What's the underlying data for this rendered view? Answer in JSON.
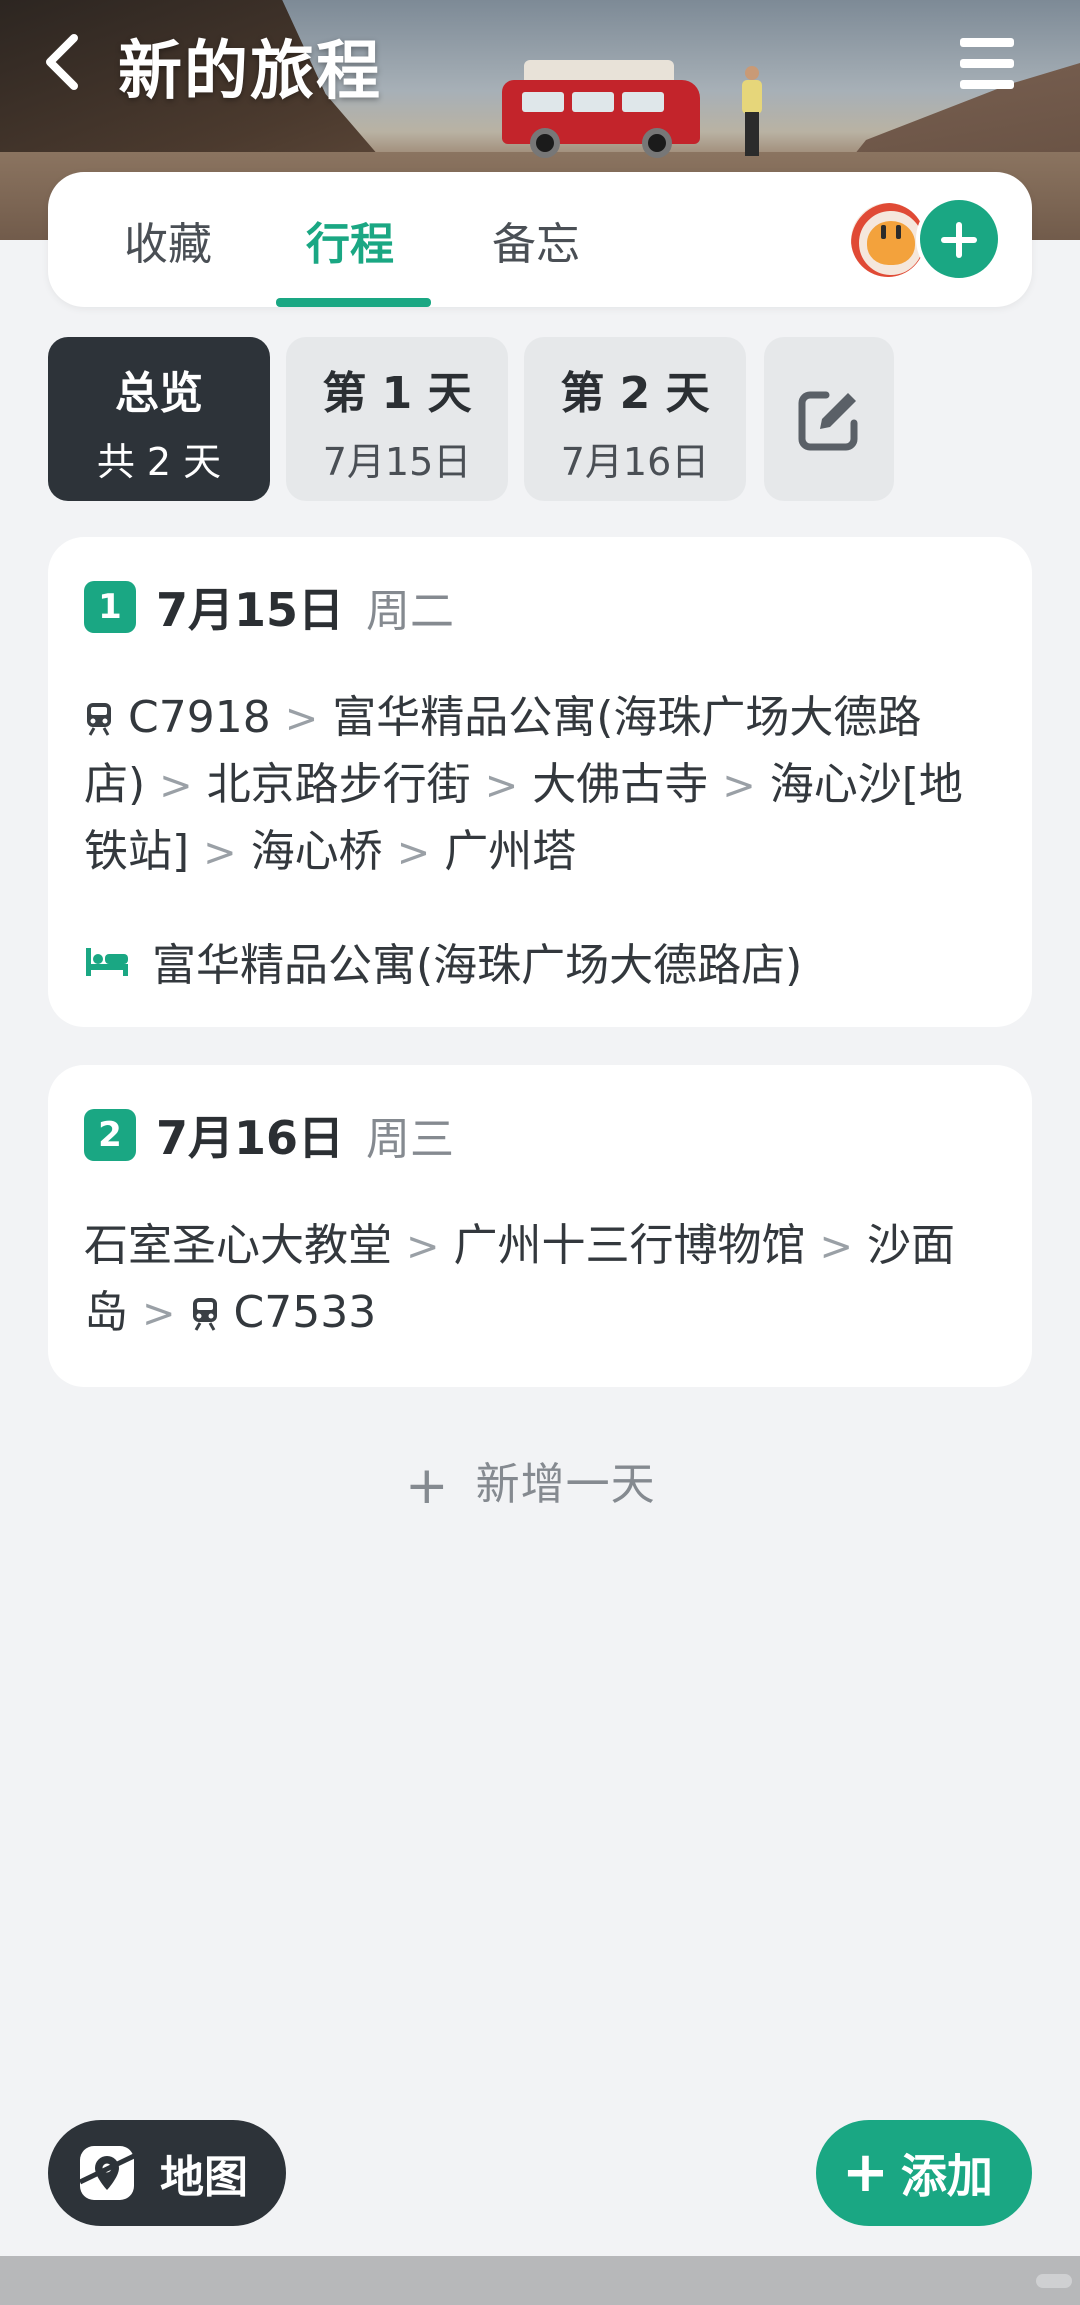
{
  "header": {
    "title": "新的旅程",
    "back_icon": "chevron-left-icon",
    "menu_icon": "hamburger-menu-icon"
  },
  "tabs": [
    {
      "label": "收藏",
      "active": false
    },
    {
      "label": "行程",
      "active": true
    },
    {
      "label": "备忘",
      "active": false
    }
  ],
  "colors": {
    "accent": "#1aa783",
    "dark": "#2d3339",
    "background": "#f2f3f5"
  },
  "day_tabs": [
    {
      "title": "总览",
      "subtitle": "共 2 天",
      "active": true
    },
    {
      "title": "第 1 天",
      "subtitle": "7月15日",
      "active": false
    },
    {
      "title": "第 2 天",
      "subtitle": "7月16日",
      "active": false
    }
  ],
  "days": [
    {
      "badge": "1",
      "date": "7月15日",
      "weekday": "周二",
      "stops": [
        {
          "name": "C7918",
          "icon": "train-icon"
        },
        {
          "name": "富华精品公寓(海珠广场大德路店)"
        },
        {
          "name": "北京路步行街"
        },
        {
          "name": "大佛古寺"
        },
        {
          "name": "海心沙[地铁站]"
        },
        {
          "name": "海心桥"
        },
        {
          "name": "广州塔"
        }
      ],
      "hotel": "富华精品公寓(海珠广场大德路店)"
    },
    {
      "badge": "2",
      "date": "7月16日",
      "weekday": "周三",
      "stops": [
        {
          "name": "石室圣心大教堂"
        },
        {
          "name": "广州十三行博物馆"
        },
        {
          "name": "沙面岛"
        },
        {
          "name": "C7533",
          "icon": "train-icon"
        }
      ]
    }
  ],
  "add_day_label": "新增一天",
  "bottom": {
    "map_label": "地图",
    "add_label": "添加"
  }
}
